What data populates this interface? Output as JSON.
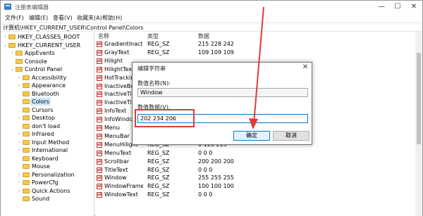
{
  "window": {
    "title": "注册表编辑器",
    "controls": {
      "minimize": "—",
      "maximize": "☐",
      "close": "✕"
    }
  },
  "menu": [
    "文件(F)",
    "编辑(E)",
    "查看(V)",
    "收藏夹(A)",
    "帮助(H)"
  ],
  "address": "计算机\\HKEY_CURRENT_USER\\Control Panel\\Colors",
  "tree": {
    "items": [
      {
        "label": "HKEY_CLASSES_ROOT",
        "arrow": "›"
      },
      {
        "label": "HKEY_CURRENT_USER",
        "arrow": "⌄"
      },
      {
        "label": "AppEvents",
        "arrow": "›"
      },
      {
        "label": "Console",
        "arrow": ""
      },
      {
        "label": "Control Panel",
        "arrow": "⌄"
      },
      {
        "label": "Accessibility",
        "arrow": "›"
      },
      {
        "label": "Appearance",
        "arrow": "›"
      },
      {
        "label": "Bluetooth",
        "arrow": ""
      },
      {
        "label": "Colors",
        "arrow": ""
      },
      {
        "label": "Cursors",
        "arrow": ""
      },
      {
        "label": "Desktop",
        "arrow": "›"
      },
      {
        "label": "don't load",
        "arrow": ""
      },
      {
        "label": "Infrared",
        "arrow": "›"
      },
      {
        "label": "Input Method",
        "arrow": "›"
      },
      {
        "label": "International",
        "arrow": "›"
      },
      {
        "label": "Keyboard",
        "arrow": ""
      },
      {
        "label": "Mouse",
        "arrow": ""
      },
      {
        "label": "Personalization",
        "arrow": "›"
      },
      {
        "label": "PowerCfg",
        "arrow": "›"
      },
      {
        "label": "Quick Actions",
        "arrow": "›"
      },
      {
        "label": "Sound",
        "arrow": ""
      }
    ]
  },
  "list": {
    "headers": {
      "name": "名称",
      "type": "类型",
      "data": "数据"
    },
    "icon_text": "ab",
    "rows": [
      {
        "name": "GradientInacti...",
        "type": "REG_SZ",
        "data": "215 228 242"
      },
      {
        "name": "GrayText",
        "type": "REG_SZ",
        "data": "109 109 109"
      },
      {
        "name": "Hilight",
        "type": "",
        "data": ""
      },
      {
        "name": "HilightText",
        "type": "",
        "data": ""
      },
      {
        "name": "HotTracking",
        "type": "",
        "data": ""
      },
      {
        "name": "InactiveBor",
        "type": "",
        "data": ""
      },
      {
        "name": "InactiveTitle",
        "type": "",
        "data": ""
      },
      {
        "name": "InactiveTitle",
        "type": "",
        "data": ""
      },
      {
        "name": "InfoText",
        "type": "",
        "data": ""
      },
      {
        "name": "InfoWindow",
        "type": "",
        "data": ""
      },
      {
        "name": "Menu",
        "type": "",
        "data": ""
      },
      {
        "name": "MenuBar",
        "type": "",
        "data": ""
      },
      {
        "name": "MenuHilight",
        "type": "REG_SZ",
        "data": "0 120 215"
      },
      {
        "name": "MenuText",
        "type": "REG_SZ",
        "data": "0 0 0"
      },
      {
        "name": "Scrollbar",
        "type": "REG_SZ",
        "data": "200 200 200"
      },
      {
        "name": "TitleText",
        "type": "REG_SZ",
        "data": "0 0 0"
      },
      {
        "name": "Window",
        "type": "REG_SZ",
        "data": "255 255 255"
      },
      {
        "name": "WindowFrame",
        "type": "REG_SZ",
        "data": "100 100 100"
      },
      {
        "name": "WindowText",
        "type": "REG_SZ",
        "data": "0 0 0"
      }
    ]
  },
  "dialog": {
    "title": "编辑字符串",
    "close": "✕",
    "name_label": "数值名称(N):",
    "name_value": "Window",
    "data_label": "数值数据(V):",
    "data_value": "202 234 206",
    "ok": "确定",
    "cancel": "取消"
  },
  "colors": {
    "annotation": "#e03b3b",
    "selection": "#cce8ff",
    "accent": "#0078d7"
  }
}
